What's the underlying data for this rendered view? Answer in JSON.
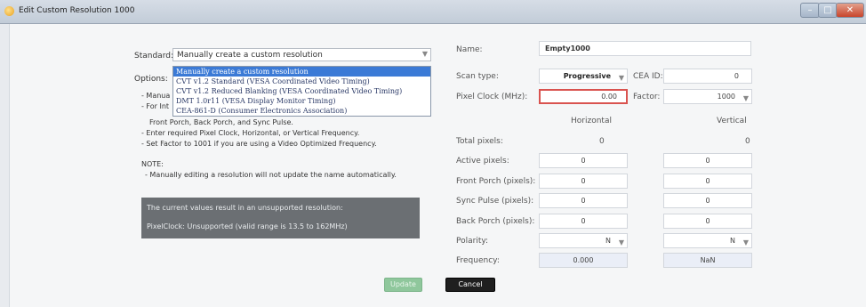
{
  "window": {
    "title": "Edit Custom Resolution 1000"
  },
  "left": {
    "standard_label": "Standard:",
    "standard_value": "Manually create a custom resolution",
    "options_label": "Options:",
    "dropdown_options": [
      "Manually create a custom resolution",
      "CVT v1.2 Standard (VESA Coordinated Video Timing)",
      "CVT v1.2 Reduced Blanking (VESA Coordinated Video Timing)",
      "DMT 1.0r11 (VESA Display Monitor Timing)",
      "CEA-861-D (Consumer Electronics Association)"
    ],
    "obscured_1": "- Manua",
    "obscured_2": "- For Int",
    "obscured_3": "Front Porch, Back Porch, and Sync Pulse.",
    "instructions": [
      "- Enter required Pixel Clock, Horizontal, or Vertical Frequency.",
      "- Set Factor to 1001 if you are using a Video Optimized Frequency."
    ],
    "note_label": "NOTE:",
    "note_text": "- Manually editing a resolution will not update the name automatically.",
    "warning_line1": "The current values result in an unsupported resolution:",
    "warning_line2": "PixelClock: Unsupported (valid range is 13.5 to 162MHz)"
  },
  "right": {
    "name_label": "Name:",
    "name_value": "Empty1000",
    "scan_type_label": "Scan type:",
    "scan_type_value": "Progressive",
    "cea_id_label": "CEA ID:",
    "cea_id_value": "0",
    "pixel_clock_label": "Pixel Clock (MHz):",
    "pixel_clock_value": "0.00",
    "factor_label": "Factor:",
    "factor_value": "1000",
    "horizontal_header": "Horizontal",
    "vertical_header": "Vertical",
    "total_pixels_label": "Total pixels:",
    "total_pixels_h": "0",
    "total_pixels_v": "0",
    "rows": [
      {
        "label": "Active pixels:",
        "h": "0",
        "v": "0"
      },
      {
        "label": "Front Porch (pixels):",
        "h": "0",
        "v": "0"
      },
      {
        "label": "Sync Pulse (pixels):",
        "h": "0",
        "v": "0"
      },
      {
        "label": "Back Porch (pixels):",
        "h": "0",
        "v": "0"
      }
    ],
    "polarity_label": "Polarity:",
    "polarity_h": "N",
    "polarity_v": "N",
    "frequency_label": "Frequency:",
    "frequency_h": "0.000",
    "frequency_v": "NaN"
  },
  "buttons": {
    "update": "Update",
    "cancel": "Cancel"
  },
  "colors": {
    "accent": "#3b7ad6",
    "error_border": "#d9534f",
    "update_disabled": "#8fc79c",
    "warning_bg": "#6b6f73"
  }
}
